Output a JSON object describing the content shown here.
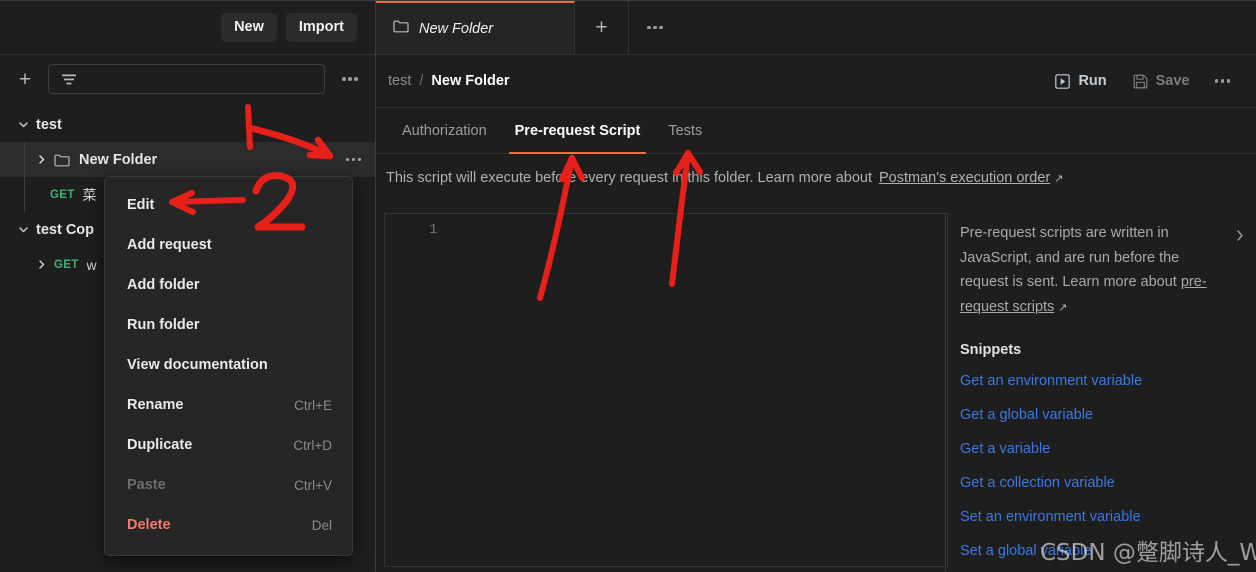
{
  "sidebar": {
    "new_button": "New",
    "import_button": "Import",
    "filter_placeholder": "",
    "tree": [
      {
        "label": "test",
        "type": "collection",
        "indent": 0,
        "expanded": true,
        "selected": false
      },
      {
        "label": "New Folder",
        "type": "folder",
        "indent": 1,
        "expanded": false,
        "selected": true
      },
      {
        "label": "菜",
        "type": "request",
        "method": "GET",
        "indent": 2,
        "selected": false
      },
      {
        "label": "test Cop",
        "type": "collection",
        "indent": 0,
        "expanded": true,
        "selected": false
      },
      {
        "label": "w",
        "type": "request",
        "method": "GET",
        "indent": 1,
        "selected": false
      }
    ]
  },
  "context_menu": {
    "items": [
      {
        "label": "Edit",
        "shortcut": "",
        "state": "normal"
      },
      {
        "label": "Add request",
        "shortcut": "",
        "state": "normal"
      },
      {
        "label": "Add folder",
        "shortcut": "",
        "state": "normal"
      },
      {
        "label": "Run folder",
        "shortcut": "",
        "state": "normal"
      },
      {
        "label": "View documentation",
        "shortcut": "",
        "state": "normal"
      },
      {
        "label": "Rename",
        "shortcut": "Ctrl+E",
        "state": "normal"
      },
      {
        "label": "Duplicate",
        "shortcut": "Ctrl+D",
        "state": "normal"
      },
      {
        "label": "Paste",
        "shortcut": "Ctrl+V",
        "state": "disabled"
      },
      {
        "label": "Delete",
        "shortcut": "Del",
        "state": "danger"
      }
    ]
  },
  "tabbar": {
    "tab_title": "New Folder",
    "new_tab_icon": "plus-icon",
    "more_icon": "ellipsis-icon"
  },
  "header": {
    "breadcrumb_parent": "test",
    "breadcrumb_separator": "/",
    "breadcrumb_current": "New Folder",
    "run_label": "Run",
    "save_label": "Save",
    "more_icon": "ellipsis-icon"
  },
  "subtabs": [
    {
      "label": "Authorization",
      "active": false
    },
    {
      "label": "Pre-request Script",
      "active": true
    },
    {
      "label": "Tests",
      "active": false
    }
  ],
  "description": {
    "text": "This script will execute before every request in this folder. Learn more about",
    "link": "Postman's execution order",
    "external_glyph": "↗"
  },
  "editor": {
    "line_number": "1",
    "content": ""
  },
  "help_panel": {
    "paragraph": "Pre-request scripts are written in JavaScript, and are run before the request is sent. Learn more about",
    "paragraph_link": "pre-request scripts",
    "external_glyph": "↗",
    "collapse_icon": "chevron-right-icon",
    "snippets_title": "Snippets",
    "snippets": [
      "Get an environment variable",
      "Get a global variable",
      "Get a variable",
      "Get a collection variable",
      "Set an environment variable",
      "Set a global variable"
    ]
  },
  "annotations": {
    "marker_color": "#e8201a",
    "label_1": "1",
    "label_2": "2"
  },
  "watermark": "CSDN @蹩脚诗人_Ww",
  "colors": {
    "accent_orange": "#f26b3a",
    "method_get_green": "#3bb273",
    "link_blue": "#3b78e7",
    "danger_red": "#f27a6e",
    "bg": "#1e1e1e",
    "panel_bg": "#262626"
  }
}
